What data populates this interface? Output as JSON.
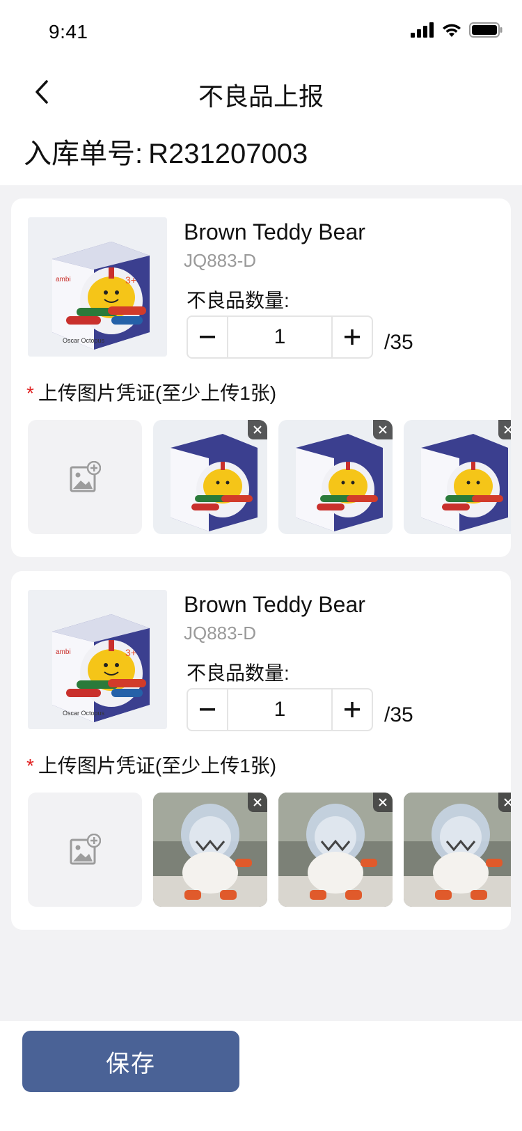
{
  "status_bar": {
    "time": "9:41"
  },
  "nav": {
    "title": "不良品上报"
  },
  "order": {
    "label": "入库单号:",
    "number": "R231207003"
  },
  "items": [
    {
      "name": "Brown Teddy Bear",
      "sku": "JQ883-D",
      "qty_label": "不良品数量:",
      "qty_value": "1",
      "qty_total": "/35",
      "upload_required_mark": "*",
      "upload_label": "上传图片凭证(至少上传1张)",
      "photos": [
        "toy-box-photo",
        "toy-box-photo",
        "toy-box-photo"
      ]
    },
    {
      "name": "Brown Teddy Bear",
      "sku": "JQ883-D",
      "qty_label": "不良品数量:",
      "qty_value": "1",
      "qty_total": "/35",
      "upload_required_mark": "*",
      "upload_label": "上传图片凭证(至少上传1张)",
      "photos": [
        "astronaut-figure-photo",
        "astronaut-figure-photo",
        "astronaut-figure-photo"
      ]
    }
  ],
  "footer": {
    "save_label": "保存"
  },
  "colors": {
    "primary": "#4a6296",
    "required": "#e02020",
    "page_bg": "#f2f2f4"
  },
  "icons": {
    "back": "chevron-left-icon",
    "add_photo": "image-add-icon",
    "delete": "close-icon"
  }
}
